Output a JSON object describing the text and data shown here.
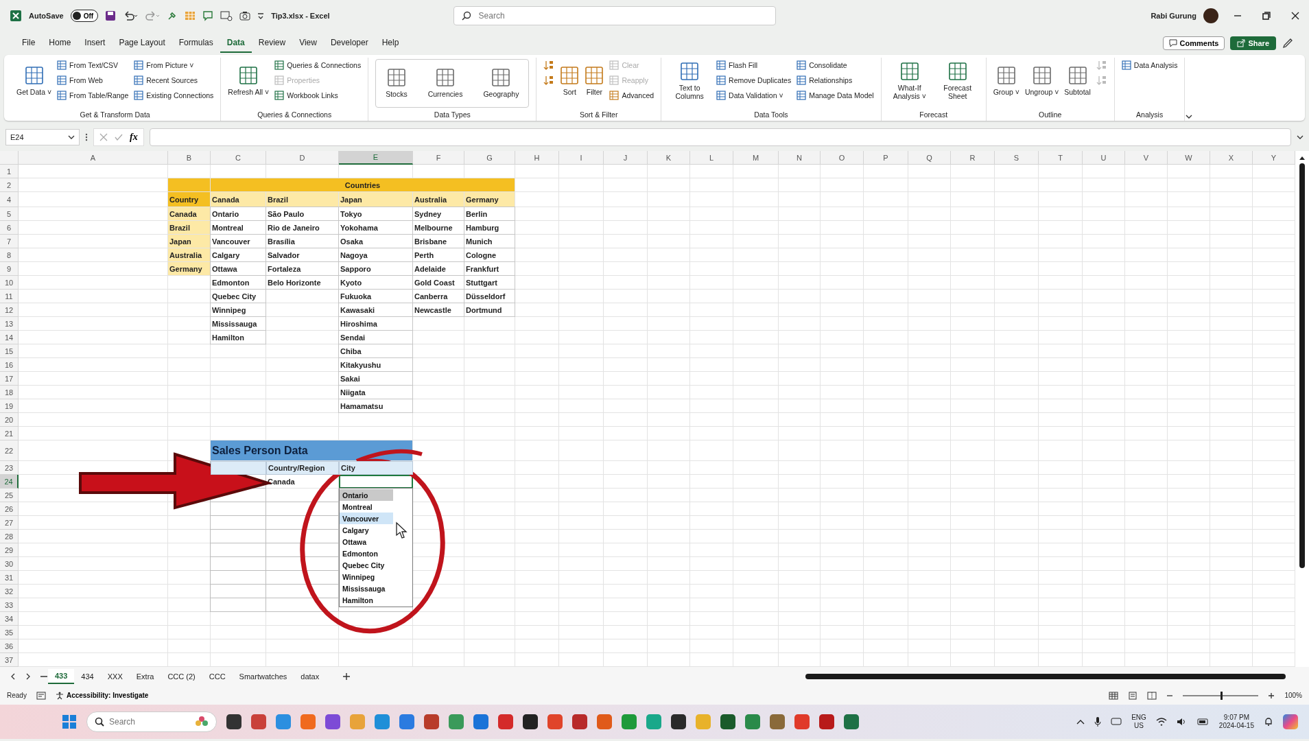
{
  "title_bar": {
    "autosave_label": "AutoSave",
    "autosave_toggle": {
      "label": "Off",
      "on": false
    },
    "document_title": "Tip3.xlsx - Excel",
    "search": {
      "placeholder": "Search"
    },
    "user_name": "Rabi Gurung"
  },
  "ribbon_tabs": [
    {
      "label": "File",
      "selected": false
    },
    {
      "label": "Home",
      "selected": false
    },
    {
      "label": "Insert",
      "selected": false
    },
    {
      "label": "Page Layout",
      "selected": false
    },
    {
      "label": "Formulas",
      "selected": false
    },
    {
      "label": "Data",
      "selected": true
    },
    {
      "label": "Review",
      "selected": false
    },
    {
      "label": "View",
      "selected": false
    },
    {
      "label": "Developer",
      "selected": false
    },
    {
      "label": "Help",
      "selected": false
    }
  ],
  "ribbon_actions": {
    "comments": "Comments",
    "share": "Share"
  },
  "ribbon_groups": [
    {
      "name": "Get & Transform Data",
      "kind": "plain",
      "items": [
        {
          "kind": "large",
          "label": "Get Data ˅",
          "disabled": false
        },
        {
          "kind": "small",
          "label": "From Text/CSV",
          "disabled": false
        },
        {
          "kind": "small",
          "label": "From Web",
          "disabled": false
        },
        {
          "kind": "small",
          "label": "From Table/Range",
          "disabled": false
        },
        {
          "kind": "small",
          "label": "From Picture ˅",
          "disabled": false
        },
        {
          "kind": "small",
          "label": "Recent Sources",
          "disabled": false
        },
        {
          "kind": "small",
          "label": "Existing Connections",
          "disabled": false
        }
      ]
    },
    {
      "name": "Queries & Connections",
      "kind": "plain",
      "items": [
        {
          "kind": "large",
          "label": "Refresh All ˅",
          "disabled": false
        },
        {
          "kind": "small",
          "label": "Queries & Connections",
          "disabled": false
        },
        {
          "kind": "small",
          "label": "Properties",
          "disabled": true
        },
        {
          "kind": "small",
          "label": "Workbook Links",
          "disabled": false
        }
      ]
    },
    {
      "name": "Data Types",
      "kind": "gallery",
      "items": [
        {
          "kind": "large",
          "label": "Stocks",
          "disabled": false
        },
        {
          "kind": "large",
          "label": "Currencies",
          "disabled": false
        },
        {
          "kind": "large",
          "label": "Geography",
          "disabled": false
        }
      ]
    },
    {
      "name": "Sort & Filter",
      "kind": "plain",
      "items": [
        {
          "kind": "icon",
          "disabled": false
        },
        {
          "kind": "icon",
          "disabled": false
        },
        {
          "kind": "large",
          "label": "Sort",
          "disabled": false
        },
        {
          "kind": "large",
          "label": "Filter",
          "disabled": false
        },
        {
          "kind": "small",
          "label": "Clear",
          "disabled": true
        },
        {
          "kind": "small",
          "label": "Reapply",
          "disabled": true
        },
        {
          "kind": "small",
          "label": "Advanced",
          "disabled": false
        }
      ]
    },
    {
      "name": "Data Tools",
      "kind": "plain",
      "items": [
        {
          "kind": "large",
          "label": "Text to Columns",
          "disabled": false
        },
        {
          "kind": "small",
          "label": "Flash Fill",
          "disabled": false
        },
        {
          "kind": "small",
          "label": "Remove Duplicates",
          "disabled": false
        },
        {
          "kind": "small",
          "label": "Data Validation ˅",
          "disabled": false
        },
        {
          "kind": "small",
          "label": "Consolidate",
          "disabled": false
        },
        {
          "kind": "small",
          "label": "Relationships",
          "disabled": false
        },
        {
          "kind": "small",
          "label": "Manage Data Model",
          "disabled": false
        }
      ]
    },
    {
      "name": "Forecast",
      "kind": "plain",
      "items": [
        {
          "kind": "large",
          "label": "What-If Analysis ˅",
          "disabled": false
        },
        {
          "kind": "large",
          "label": "Forecast Sheet",
          "disabled": false
        }
      ]
    },
    {
      "name": "Outline",
      "kind": "plain",
      "items": [
        {
          "kind": "large",
          "label": "Group ˅",
          "disabled": false
        },
        {
          "kind": "large",
          "label": "Ungroup ˅",
          "disabled": false
        },
        {
          "kind": "large",
          "label": "Subtotal",
          "disabled": false
        },
        {
          "kind": "icon",
          "disabled": true
        },
        {
          "kind": "icon",
          "disabled": true
        }
      ]
    },
    {
      "name": "Analysis",
      "kind": "plain",
      "items": [
        {
          "kind": "small",
          "label": "Data Analysis",
          "disabled": false
        }
      ]
    }
  ],
  "formula_bar": {
    "name_box": "E24",
    "fx": "fx"
  },
  "columns": [
    {
      "label": "A",
      "selected": false
    },
    {
      "label": "B",
      "selected": false
    },
    {
      "label": "C",
      "selected": false
    },
    {
      "label": "D",
      "selected": false
    },
    {
      "label": "E",
      "selected": true
    },
    {
      "label": "F",
      "selected": false
    },
    {
      "label": "G",
      "selected": false
    },
    {
      "label": "H",
      "selected": false
    },
    {
      "label": "I",
      "selected": false
    },
    {
      "label": "J",
      "selected": false
    },
    {
      "label": "K",
      "selected": false
    },
    {
      "label": "L",
      "selected": false
    },
    {
      "label": "M",
      "selected": false
    },
    {
      "label": "N",
      "selected": false
    },
    {
      "label": "O",
      "selected": false
    },
    {
      "label": "P",
      "selected": false
    },
    {
      "label": "Q",
      "selected": false
    },
    {
      "label": "R",
      "selected": false
    },
    {
      "label": "S",
      "selected": false
    },
    {
      "label": "T",
      "selected": false
    },
    {
      "label": "U",
      "selected": false
    },
    {
      "label": "V",
      "selected": false
    },
    {
      "label": "W",
      "selected": false
    },
    {
      "label": "X",
      "selected": false
    },
    {
      "label": "Y",
      "selected": false
    }
  ],
  "rows": [
    {
      "label": "1",
      "selected": false
    },
    {
      "label": "2",
      "selected": false
    },
    {
      "label": "4",
      "selected": false
    },
    {
      "label": "5",
      "selected": false
    },
    {
      "label": "6",
      "selected": false
    },
    {
      "label": "7",
      "selected": false
    },
    {
      "label": "8",
      "selected": false
    },
    {
      "label": "9",
      "selected": false
    },
    {
      "label": "10",
      "selected": false
    },
    {
      "label": "11",
      "selected": false
    },
    {
      "label": "12",
      "selected": false
    },
    {
      "label": "13",
      "selected": false
    },
    {
      "label": "14",
      "selected": false
    },
    {
      "label": "15",
      "selected": false
    },
    {
      "label": "16",
      "selected": false
    },
    {
      "label": "17",
      "selected": false
    },
    {
      "label": "18",
      "selected": false
    },
    {
      "label": "19",
      "selected": false
    },
    {
      "label": "20",
      "selected": false
    },
    {
      "label": "21",
      "selected": false
    },
    {
      "label": "22",
      "selected": false
    },
    {
      "label": "23",
      "selected": false
    },
    {
      "label": "24",
      "selected": true
    },
    {
      "label": "25",
      "selected": false
    },
    {
      "label": "26",
      "selected": false
    },
    {
      "label": "27",
      "selected": false
    },
    {
      "label": "28",
      "selected": false
    },
    {
      "label": "29",
      "selected": false
    },
    {
      "label": "30",
      "selected": false
    },
    {
      "label": "31",
      "selected": false
    },
    {
      "label": "32",
      "selected": false
    },
    {
      "label": "33",
      "selected": false
    },
    {
      "label": "34",
      "selected": false
    },
    {
      "label": "35",
      "selected": false
    },
    {
      "label": "36",
      "selected": false
    },
    {
      "label": "37",
      "selected": false
    }
  ],
  "countries_table": {
    "title": "Countries",
    "list_header": "Country",
    "list": [
      "Canada",
      "Brazil",
      "Japan",
      "Australia",
      "Germany"
    ],
    "columns": [
      {
        "name": "Canada",
        "cities": [
          "Ontario",
          "Montreal",
          "Vancouver",
          "Calgary",
          "Ottawa",
          "Edmonton",
          "Quebec City",
          "Winnipeg",
          "Mississauga",
          "Hamilton"
        ]
      },
      {
        "name": "Brazil",
        "cities": [
          "São Paulo",
          "Rio de Janeiro",
          "Brasília",
          "Salvador",
          "Fortaleza",
          "Belo Horizonte"
        ]
      },
      {
        "name": "Japan",
        "cities": [
          "Tokyo",
          "Yokohama",
          "Osaka",
          "Nagoya",
          "Sapporo",
          "Kyoto",
          "Fukuoka",
          "Kawasaki",
          "Hiroshima",
          "Sendai",
          "Chiba",
          "Kitakyushu",
          "Sakai",
          "Niigata",
          "Hamamatsu"
        ]
      },
      {
        "name": "Australia",
        "cities": [
          "Sydney",
          "Melbourne",
          "Brisbane",
          "Perth",
          "Adelaide",
          "Gold Coast",
          "Canberra",
          "Newcastle"
        ]
      },
      {
        "name": "Germany",
        "cities": [
          "Berlin",
          "Hamburg",
          "Munich",
          "Cologne",
          "Frankfurt",
          "Stuttgart",
          "Düsseldorf",
          "Dortmund"
        ]
      }
    ]
  },
  "sales_table": {
    "title": "Sales Person Data",
    "headers": [
      "Country/Region",
      "City"
    ],
    "rows": [
      {
        "country_region": "Canada",
        "city_active": true
      }
    ],
    "city_dropdown": [
      {
        "label": "Ontario",
        "selected": true,
        "hovered": false
      },
      {
        "label": "Montreal",
        "selected": false,
        "hovered": false
      },
      {
        "label": "Vancouver",
        "selected": false,
        "hovered": true
      },
      {
        "label": "Calgary",
        "selected": false,
        "hovered": false
      },
      {
        "label": "Ottawa",
        "selected": false,
        "hovered": false
      },
      {
        "label": "Edmonton",
        "selected": false,
        "hovered": false
      },
      {
        "label": "Quebec City",
        "selected": false,
        "hovered": false
      },
      {
        "label": "Winnipeg",
        "selected": false,
        "hovered": false
      },
      {
        "label": "Mississauga",
        "selected": false,
        "hovered": false
      },
      {
        "label": "Hamilton",
        "selected": false,
        "hovered": false
      }
    ]
  },
  "sheet_tabs": [
    {
      "label": "433",
      "selected": true
    },
    {
      "label": "434",
      "selected": false
    },
    {
      "label": "XXX",
      "selected": false
    },
    {
      "label": "Extra",
      "selected": false
    },
    {
      "label": "CCC (2)",
      "selected": false
    },
    {
      "label": "CCC",
      "selected": false
    },
    {
      "label": "Smartwatches",
      "selected": false
    },
    {
      "label": "datax",
      "selected": false
    }
  ],
  "status_bar": {
    "ready": "Ready",
    "accessibility": "Accessibility: Investigate",
    "zoom": "100%",
    "zoom_slider": {
      "level": 0.5
    }
  },
  "taskbar": {
    "search": {
      "placeholder": "Search"
    },
    "language": "ENG",
    "region": "US",
    "time": "9:07 PM",
    "date": "2024-04-15"
  }
}
